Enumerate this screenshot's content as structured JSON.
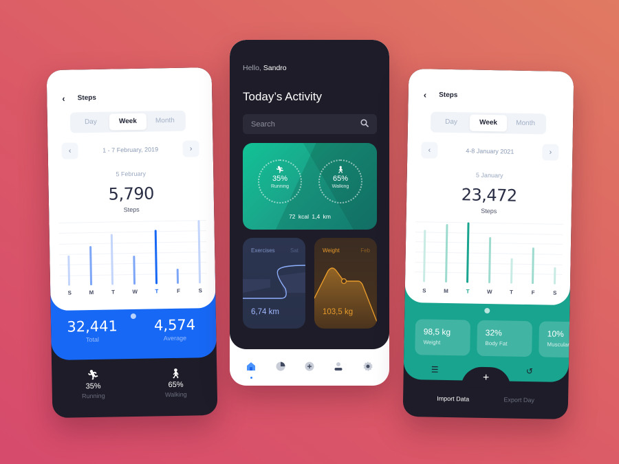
{
  "colors": {
    "blue_accent": "#1768f5",
    "teal_accent": "#18a48f",
    "dark_bg": "#1d1c28",
    "orange_accent": "#e69a2a"
  },
  "left_phone": {
    "title": "Steps",
    "back_icon": "chevron-left-icon",
    "segments": [
      "Day",
      "Week",
      "Month"
    ],
    "active_segment": "Week",
    "date_range": "1 - 7 February, 2019",
    "selected_date": "5 February",
    "steps_value": "5,790",
    "steps_label": "Steps",
    "chart": {
      "days": [
        "S",
        "M",
        "T",
        "W",
        "T",
        "F",
        "S"
      ],
      "values": [
        0.48,
        0.62,
        0.8,
        0.46,
        0.86,
        0.24,
        1.0
      ],
      "highlight_index": 4
    },
    "total_value": "32,441",
    "total_label": "Total",
    "average_value": "4,574",
    "average_label": "Average",
    "running": {
      "value": "35%",
      "label": "Running",
      "icon": "running-icon"
    },
    "walking": {
      "value": "65%",
      "label": "Walking",
      "icon": "walking-icon"
    }
  },
  "center_phone": {
    "greeting": "Hello,",
    "name": "Sandro",
    "title": "Today’s Activity",
    "search_placeholder": "Search",
    "activity_card": {
      "running": {
        "value": "35%",
        "label": "Running"
      },
      "walking": {
        "value": "65%",
        "label": "Walking"
      },
      "kcal": "72 kcal",
      "distance": "1,4 km"
    },
    "exercises_card": {
      "title": "Exercises",
      "meta": "Sat",
      "value": "6,74 km"
    },
    "weight_card": {
      "title": "Weight",
      "meta": "Feb",
      "value": "103,5 kg"
    },
    "tabs": [
      {
        "name": "home",
        "active": true
      },
      {
        "name": "stats",
        "active": false
      },
      {
        "name": "add",
        "active": false
      },
      {
        "name": "profile",
        "active": false
      },
      {
        "name": "settings",
        "active": false
      }
    ]
  },
  "right_phone": {
    "title": "Steps",
    "segments": [
      "Day",
      "Week",
      "Month"
    ],
    "active_segment": "Week",
    "date_range": "4-8 January 2021",
    "selected_date": "5 January",
    "steps_value": "23,472",
    "steps_label": "Steps",
    "chart": {
      "days": [
        "S",
        "M",
        "T",
        "W",
        "T",
        "F",
        "S"
      ],
      "values": [
        0.86,
        0.97,
        1.0,
        0.76,
        0.42,
        0.6,
        0.28
      ],
      "highlight_index": 2
    },
    "tiles": [
      {
        "value": "98,5 kg",
        "label": "Weight"
      },
      {
        "value": "32%",
        "label": "Body Fat"
      },
      {
        "value": "10%",
        "label": "Muscular"
      }
    ],
    "import_label": "Import Data",
    "export_label": "Export Day"
  }
}
